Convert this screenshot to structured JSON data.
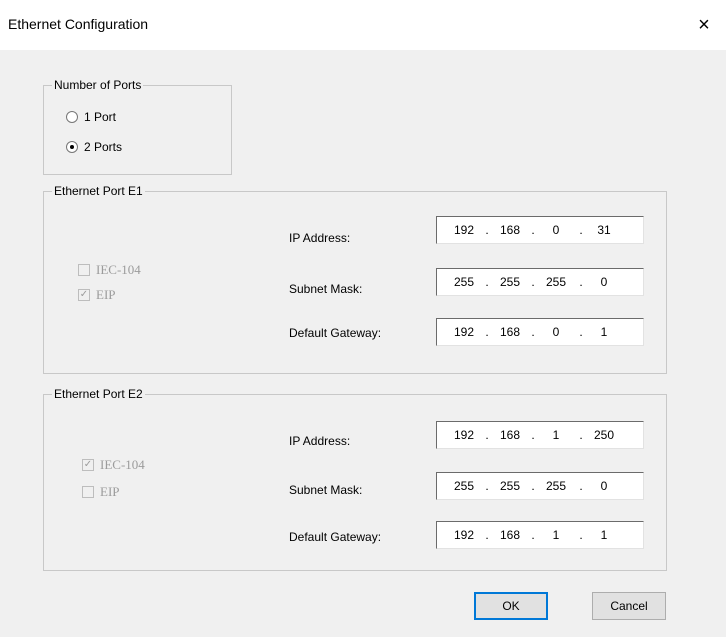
{
  "window": {
    "title": "Ethernet Configuration",
    "close_glyph": "×"
  },
  "ports_group": {
    "legend": "Number of Ports",
    "options": [
      {
        "label": "1 Port",
        "selected": false
      },
      {
        "label": "2 Ports",
        "selected": true
      }
    ]
  },
  "port_e1": {
    "legend": "Ethernet Port E1",
    "protocols": [
      {
        "label": "IEC-104",
        "checked": false,
        "glyph": ""
      },
      {
        "label": "EIP",
        "checked": true,
        "glyph": "✓"
      }
    ],
    "ip_label": "IP Address:",
    "mask_label": "Subnet Mask:",
    "gateway_label": "Default Gateway:",
    "ip": [
      "192",
      "168",
      "0",
      "31"
    ],
    "mask": [
      "255",
      "255",
      "255",
      "0"
    ],
    "gateway": [
      "192",
      "168",
      "0",
      "1"
    ]
  },
  "port_e2": {
    "legend": "Ethernet Port E2",
    "protocols": [
      {
        "label": "IEC-104",
        "checked": true,
        "glyph": "✓"
      },
      {
        "label": "EIP",
        "checked": false,
        "glyph": ""
      }
    ],
    "ip_label": "IP Address:",
    "mask_label": "Subnet Mask:",
    "gateway_label": "Default Gateway:",
    "ip": [
      "192",
      "168",
      "1",
      "250"
    ],
    "mask": [
      "255",
      "255",
      "255",
      "0"
    ],
    "gateway": [
      "192",
      "168",
      "1",
      "1"
    ]
  },
  "buttons": {
    "ok": "OK",
    "cancel": "Cancel"
  },
  "ip_separator": "."
}
